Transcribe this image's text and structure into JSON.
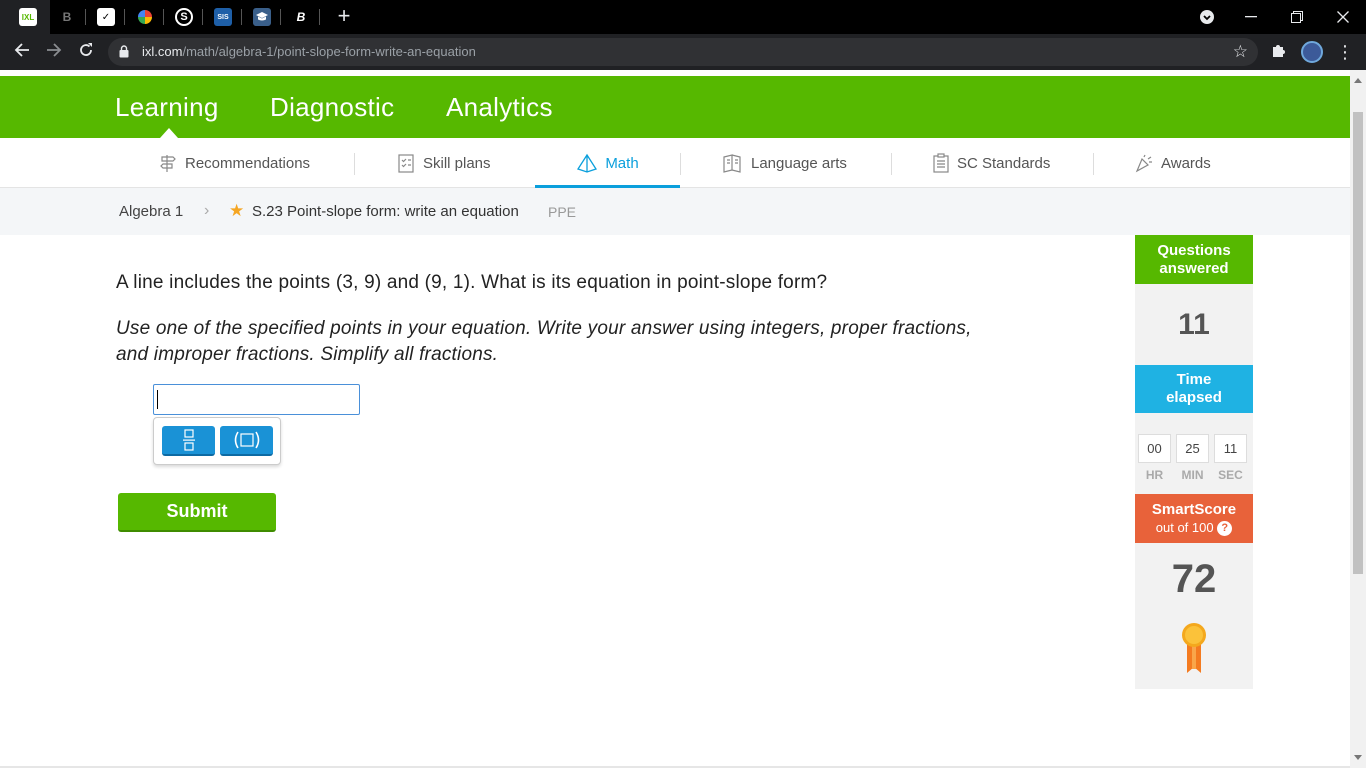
{
  "browser": {
    "url_host": "ixl.com",
    "url_path": "/math/algebra-1/point-slope-form-write-an-equation",
    "tabs": [
      "IXL",
      "B",
      "",
      "",
      "S",
      "SIS",
      "",
      "B"
    ]
  },
  "topnav": {
    "items": [
      "Learning",
      "Diagnostic",
      "Analytics"
    ]
  },
  "subnav": {
    "items": [
      "Recommendations",
      "Skill plans",
      "Math",
      "Language arts",
      "SC Standards",
      "Awards"
    ]
  },
  "breadcrumb": {
    "course": "Algebra 1",
    "skill": "S.23 Point-slope form: write an equation",
    "code": "PPE"
  },
  "question": {
    "prompt": "A line includes the points (3, 9) and (9, 1). What is its equation in point-slope form?",
    "instructions": "Use one of the specified points in your equation. Write your answer using integers, proper fractions, and improper fractions. Simplify all fractions.",
    "answer_value": "",
    "submit_label": "Submit"
  },
  "sidebar": {
    "questions_answered_label_1": "Questions",
    "questions_answered_label_2": "answered",
    "questions_answered": "11",
    "time_elapsed_label_1": "Time",
    "time_elapsed_label_2": "elapsed",
    "time": {
      "hr": "00",
      "min": "25",
      "sec": "11"
    },
    "time_units": {
      "hr": "HR",
      "min": "MIN",
      "sec": "SEC"
    },
    "smartscore_label": "SmartScore",
    "smartscore_sub": "out of 100",
    "smartscore_help": "?",
    "smartscore": "72"
  },
  "colors": {
    "ixl_green": "#56b800",
    "math_blue": "#0a9fdc",
    "time_blue": "#1fb2e3",
    "smartscore_orange": "#e8623a"
  }
}
